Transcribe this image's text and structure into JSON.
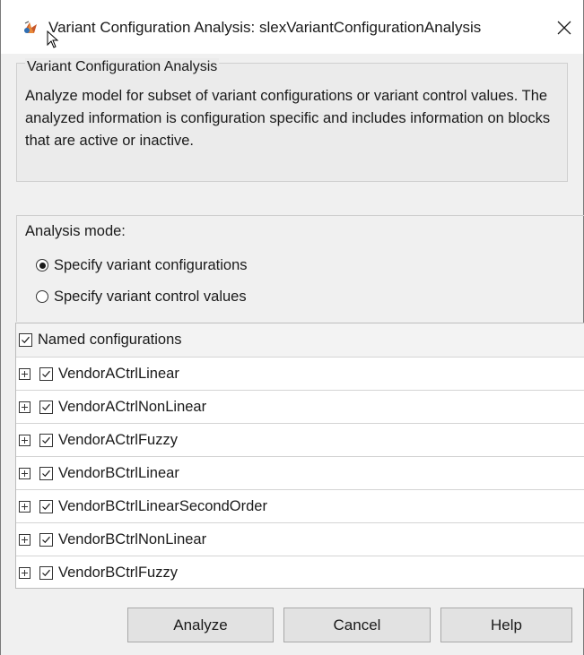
{
  "window": {
    "title": "Variant Configuration Analysis: slexVariantConfigurationAnalysis",
    "close_symbol": "✕",
    "icon": "matlab-variant-icon"
  },
  "description_group": {
    "legend": "Variant Configuration Analysis",
    "text": "Analyze model for subset of variant configurations or variant control values. The analyzed information is configuration specific and includes information on blocks that are active or inactive."
  },
  "analysis_mode": {
    "label": "Analysis mode:",
    "options": [
      {
        "label": "Specify variant configurations",
        "selected": true
      },
      {
        "label": "Specify variant control values",
        "selected": false
      }
    ]
  },
  "configurations": {
    "header": "Named configurations",
    "header_checked": true,
    "items": [
      {
        "name": "VendorACtrlLinear",
        "checked": true
      },
      {
        "name": "VendorACtrlNonLinear",
        "checked": true
      },
      {
        "name": "VendorACtrlFuzzy",
        "checked": true
      },
      {
        "name": "VendorBCtrlLinear",
        "checked": true
      },
      {
        "name": "VendorBCtrlLinearSecondOrder",
        "checked": true
      },
      {
        "name": "VendorBCtrlNonLinear",
        "checked": true
      },
      {
        "name": "VendorBCtrlFuzzy",
        "checked": true
      }
    ]
  },
  "buttons": {
    "analyze": "Analyze",
    "cancel": "Cancel",
    "help": "Help"
  }
}
